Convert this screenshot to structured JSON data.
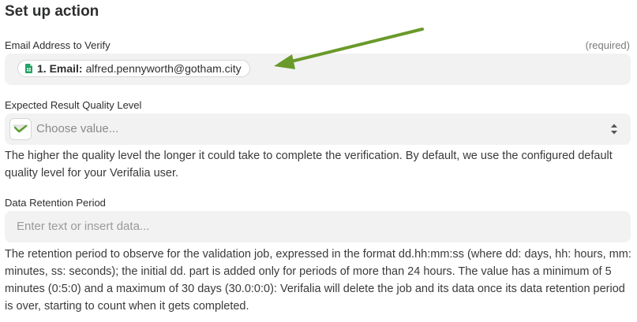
{
  "header": {
    "title": "Set up action"
  },
  "email_field": {
    "label": "Email Address to Verify",
    "required_text": "(required)",
    "pill_step": "1. Email:",
    "pill_value": "alfred.pennyworth@gotham.city",
    "pill_icon": "google-sheets-icon"
  },
  "quality_field": {
    "label": "Expected Result Quality Level",
    "placeholder": "Choose value...",
    "app_icon": "verifalia-icon",
    "help": "The higher the quality level the longer it could take to complete the verification. By default, we use the configured default quality level for your Verifalia user."
  },
  "retention_field": {
    "label": "Data Retention Period",
    "placeholder": "Enter text or insert data...",
    "help": "The retention period to observe for the validation job, expressed in the format dd.hh:mm:ss (where dd: days, hh: hours, mm: minutes, ss: seconds); the initial dd. part is added only for periods of more than 24 hours. The value has a minimum of 5 minutes (0:5:0) and a maximum of 30 days (30.0:0:0): Verifalia will delete the job and its data once its data retention period is over, starting to count when it gets completed."
  },
  "colors": {
    "field_bg": "#f2f2f2",
    "arrow": "#6a9a2a",
    "sheets_green": "#1fa463"
  }
}
